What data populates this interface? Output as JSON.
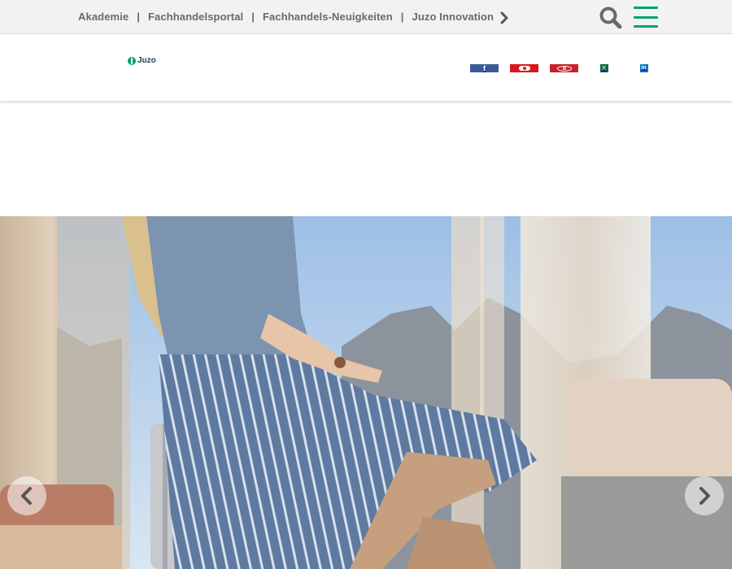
{
  "topnav": {
    "links": [
      {
        "label": "Akademie"
      },
      {
        "label": "Fachhandelsportal"
      },
      {
        "label": "Fachhandels-Neuigkeiten"
      },
      {
        "label": "Juzo Innovation"
      }
    ],
    "separator": "|",
    "more_icon": "chevron-right-icon",
    "search_icon": "search-icon",
    "menu_icon": "hamburger-menu-icon"
  },
  "header": {
    "logo_text": "Juzo",
    "social": [
      {
        "name": "facebook-icon",
        "color": "#3b5998"
      },
      {
        "name": "youtube-icon",
        "color": "#e0141c"
      },
      {
        "name": "pinterest-icon",
        "color": "#c8232c"
      },
      {
        "name": "xing-icon",
        "color": "#026466"
      },
      {
        "name": "linkedin-icon",
        "color": "#0077b5"
      }
    ]
  },
  "carousel": {
    "prev_icon": "chevron-left-icon",
    "next_icon": "chevron-right-icon"
  },
  "colors": {
    "accent": "#00a36c",
    "topbar_bg": "#f2f2f2",
    "nav_text": "#6a6a6a"
  }
}
